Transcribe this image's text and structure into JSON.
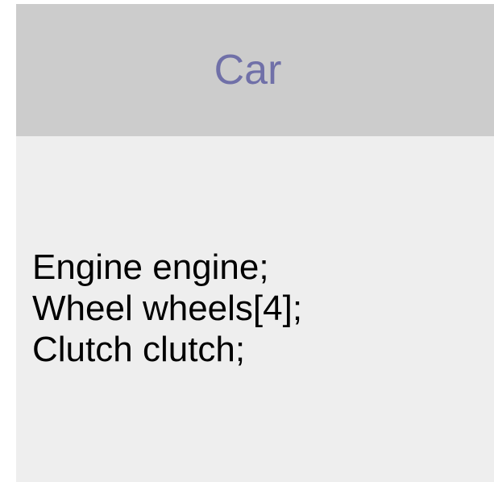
{
  "class_box": {
    "name": "Car",
    "attributes": [
      "Engine engine;",
      "Wheel wheels[4];",
      "Clutch clutch;"
    ],
    "colors": {
      "header_bg": "#cccccc",
      "body_bg": "#eeeeee",
      "name_text": "#7070a8",
      "attribute_text": "#000000"
    }
  }
}
